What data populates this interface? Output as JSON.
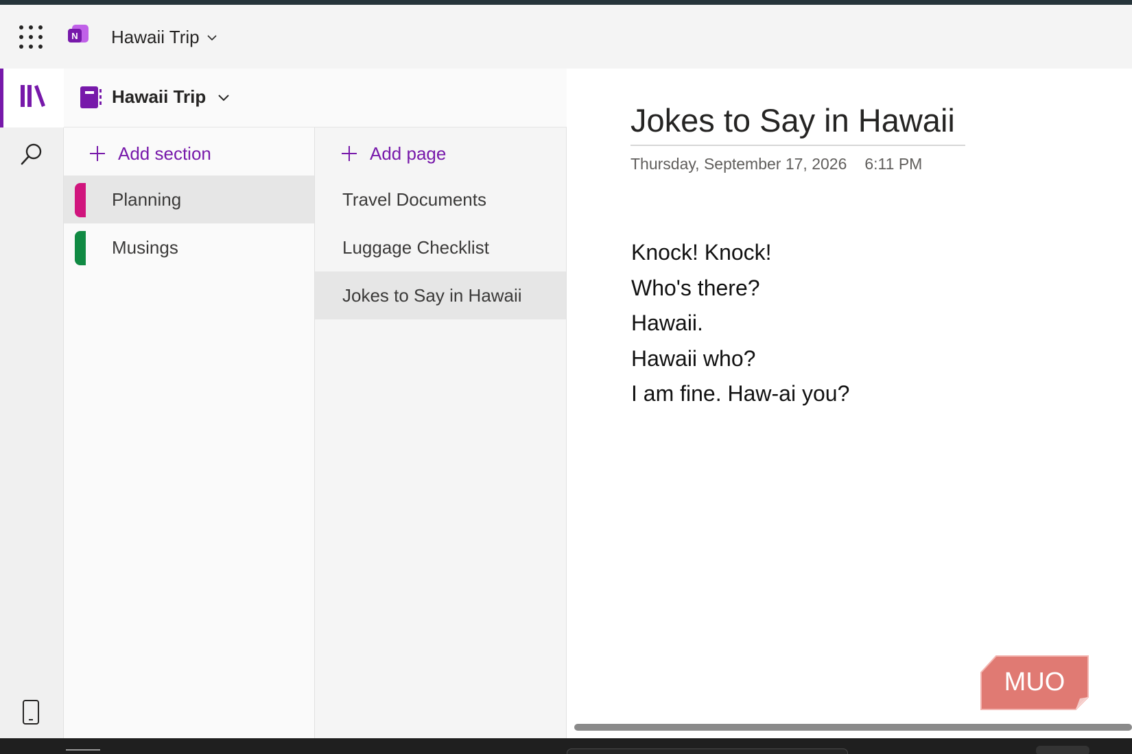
{
  "app": {
    "notebook_title": "Hawaii Trip",
    "brand_color": "#7719aa",
    "logo_icon": "onenote-logo-icon"
  },
  "rail": {
    "items": [
      {
        "icon": "notebooks-icon",
        "active": true
      },
      {
        "icon": "search-icon",
        "active": false
      },
      {
        "icon": "device-icon",
        "active": false
      }
    ]
  },
  "navigation": {
    "notebook_title": "Hawaii Trip",
    "add_section_label": "Add section",
    "add_page_label": "Add page",
    "sections": [
      {
        "label": "Planning",
        "color": "#d0157d",
        "selected": true
      },
      {
        "label": "Musings",
        "color": "#108a43",
        "selected": false
      }
    ],
    "pages": [
      {
        "label": "Travel Documents",
        "selected": false
      },
      {
        "label": "Luggage Checklist",
        "selected": false
      },
      {
        "label": "Jokes to Say in Hawaii",
        "selected": true
      }
    ]
  },
  "page": {
    "title": "Jokes to Say in Hawaii",
    "date": "Thursday, September 17, 2026",
    "time": "6:11 PM",
    "lines": [
      "Knock! Knock!",
      "Who's there?",
      "Hawaii.",
      "Hawaii who?",
      "I am fine. Haw-ai you?"
    ]
  },
  "watermark": {
    "text": "MUO",
    "color": "#e07a73"
  }
}
